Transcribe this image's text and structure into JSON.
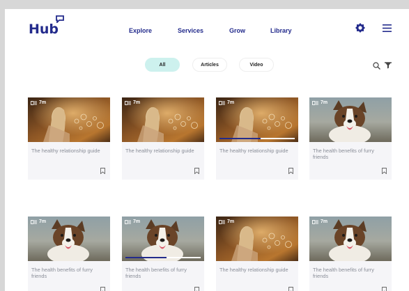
{
  "brand": {
    "name": "Hub",
    "color": "#232b8c"
  },
  "nav": [
    {
      "label": "Explore"
    },
    {
      "label": "Services"
    },
    {
      "label": "Grow"
    },
    {
      "label": "Library"
    }
  ],
  "header_icons": [
    "gear-icon",
    "hamburger-menu-icon"
  ],
  "filters": [
    {
      "label": "All",
      "active": true
    },
    {
      "label": "Articles",
      "active": false
    },
    {
      "label": "Video",
      "active": false
    }
  ],
  "tool_icons": [
    "search-icon",
    "filter-icon"
  ],
  "cards": [
    {
      "duration": "7m",
      "title": "The healthy relationship guide",
      "image": "woman-bubbles",
      "progress": null
    },
    {
      "duration": "7m",
      "title": "The healthy relationship guide",
      "image": "woman-bubbles",
      "progress": null
    },
    {
      "duration": "7m",
      "title": "The healthy relationship guide",
      "image": "woman-bubbles",
      "progress": 0.55
    },
    {
      "duration": "7m",
      "title": "The health benefits of furry friends",
      "image": "dog",
      "progress": null
    },
    {
      "duration": "7m",
      "title": "The health benefits of furry friends",
      "image": "dog",
      "progress": null
    },
    {
      "duration": "7m",
      "title": "The health benefits of furry friends",
      "image": "dog",
      "progress": 0.55
    },
    {
      "duration": "7m",
      "title": "The healthy relationship guide",
      "image": "woman-bubbles",
      "progress": null
    },
    {
      "duration": "7m",
      "title": "The health benefits of furry friends",
      "image": "dog",
      "progress": null
    }
  ]
}
